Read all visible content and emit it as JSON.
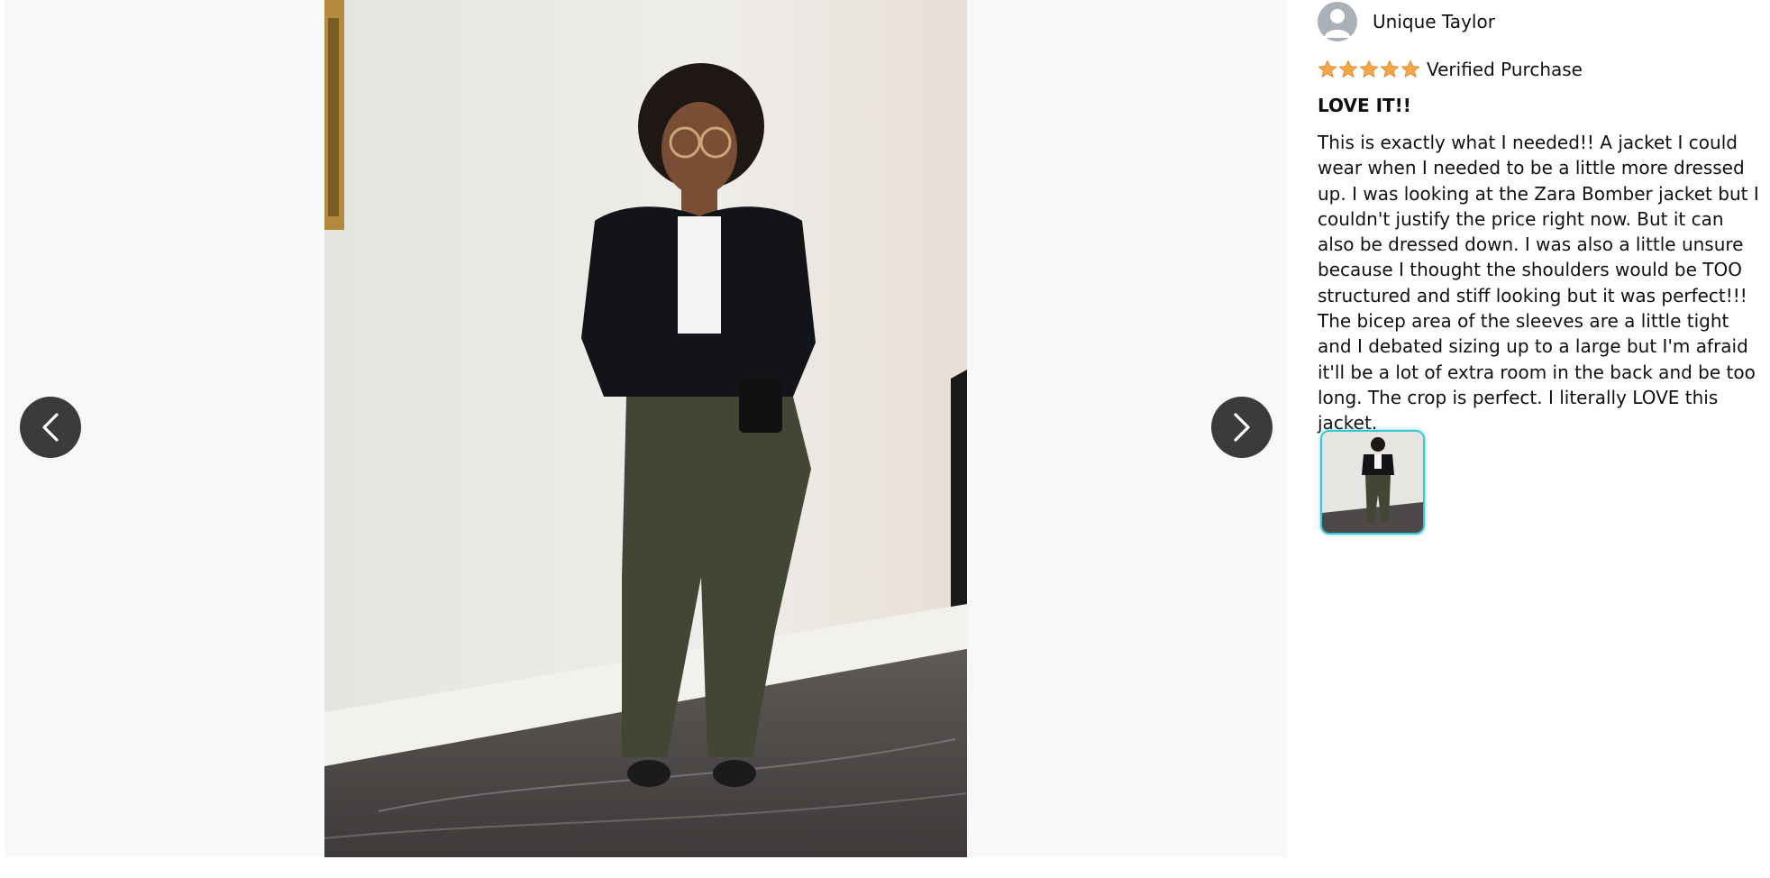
{
  "review": {
    "reviewer_name": "Unique Taylor",
    "rating": 5,
    "rating_max": 5,
    "verified_label": "Verified Purchase",
    "title": "LOVE IT!!",
    "body": "This is exactly what I needed!! A jacket I could wear when I needed to be a little more dressed up. I was looking at the Zara Bomber jacket but I couldn't justify the price right now. But it can also be dressed down. I was also a little unsure because I thought the shoulders would be TOO structured and stiff looking but it was perfect!!! The bicep area of the sleeves are a little tight and I debated sizing up to a large but I'm afraid it'll be a lot of extra room in the back and be too long. The crop is perfect. I literally LOVE this jacket."
  },
  "icons": {
    "previous": "chevron-left-icon",
    "next": "chevron-right-icon",
    "avatar": "user-silhouette-icon",
    "star": "star-icon"
  },
  "colors": {
    "star": "#f3a847",
    "thumbnail_border": "#38c8d8",
    "nav_button": "#3b3b3b",
    "viewer_background": "#f7f8f8"
  }
}
